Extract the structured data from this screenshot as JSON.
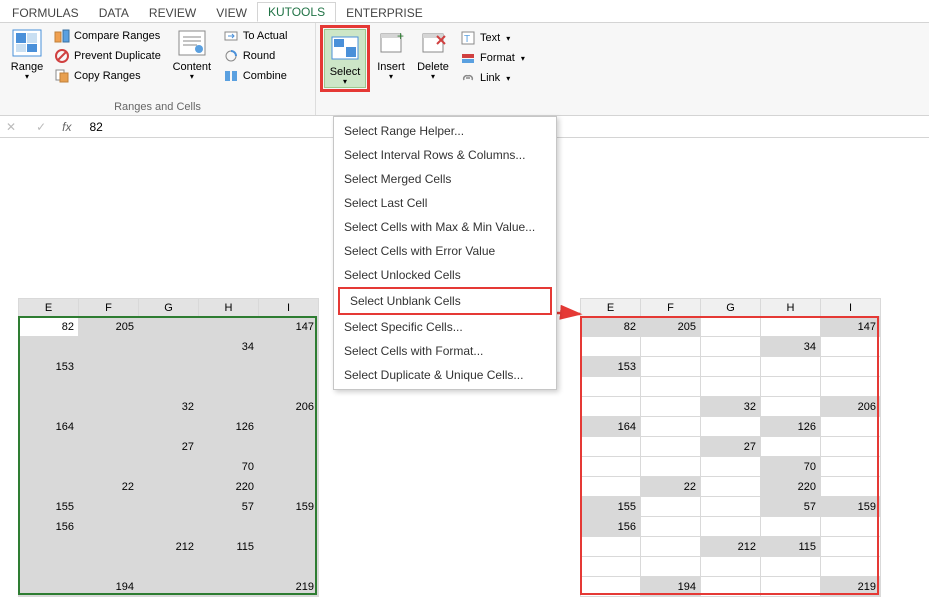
{
  "ribbon_tabs": [
    "FORMULAS",
    "DATA",
    "REVIEW",
    "VIEW",
    "KUTOOLS",
    "ENTERPRISE"
  ],
  "active_tab": "KUTOOLS",
  "ribbon": {
    "range_btn": "Range",
    "compare_ranges": "Compare Ranges",
    "prevent_duplicate": "Prevent Duplicate",
    "copy_ranges": "Copy Ranges",
    "content_btn": "Content",
    "to_actual": "To Actual",
    "round": "Round",
    "combine": "Combine",
    "group_label": "Ranges and Cells",
    "select_btn": "Select",
    "insert_btn": "Insert",
    "delete_btn": "Delete",
    "text_btn": "Text",
    "format_btn": "Format",
    "link_btn": "Link"
  },
  "formula_bar": {
    "fx": "fx",
    "value": "82"
  },
  "dropdown_items": [
    "Select Range Helper...",
    "Select Interval Rows & Columns...",
    "Select Merged Cells",
    "Select Last Cell",
    "Select Cells with Max & Min Value...",
    "Select Cells with Error Value",
    "Select Unlocked Cells",
    "Select Unblank Cells",
    "Select Specific Cells...",
    "Select Cells with Format...",
    "Select Duplicate & Unique Cells..."
  ],
  "highlighted_item_index": 7,
  "columns": [
    "E",
    "F",
    "G",
    "H",
    "I"
  ],
  "chart_data": {
    "type": "table",
    "title": "Spreadsheet range E:I showing Select Unblank Cells",
    "columns": [
      "E",
      "F",
      "G",
      "H",
      "I"
    ],
    "rows": [
      [
        82,
        205,
        null,
        null,
        147
      ],
      [
        null,
        null,
        null,
        34,
        null
      ],
      [
        153,
        null,
        null,
        null,
        null
      ],
      [
        null,
        null,
        null,
        null,
        null
      ],
      [
        null,
        null,
        32,
        null,
        206
      ],
      [
        164,
        null,
        null,
        126,
        null
      ],
      [
        null,
        null,
        27,
        null,
        null
      ],
      [
        null,
        null,
        null,
        70,
        null
      ],
      [
        null,
        22,
        null,
        220,
        null
      ],
      [
        155,
        null,
        null,
        57,
        159
      ],
      [
        156,
        null,
        null,
        null,
        null
      ],
      [
        null,
        null,
        212,
        115,
        null
      ],
      [
        null,
        null,
        null,
        null,
        null
      ],
      [
        null,
        194,
        null,
        null,
        219
      ]
    ]
  }
}
